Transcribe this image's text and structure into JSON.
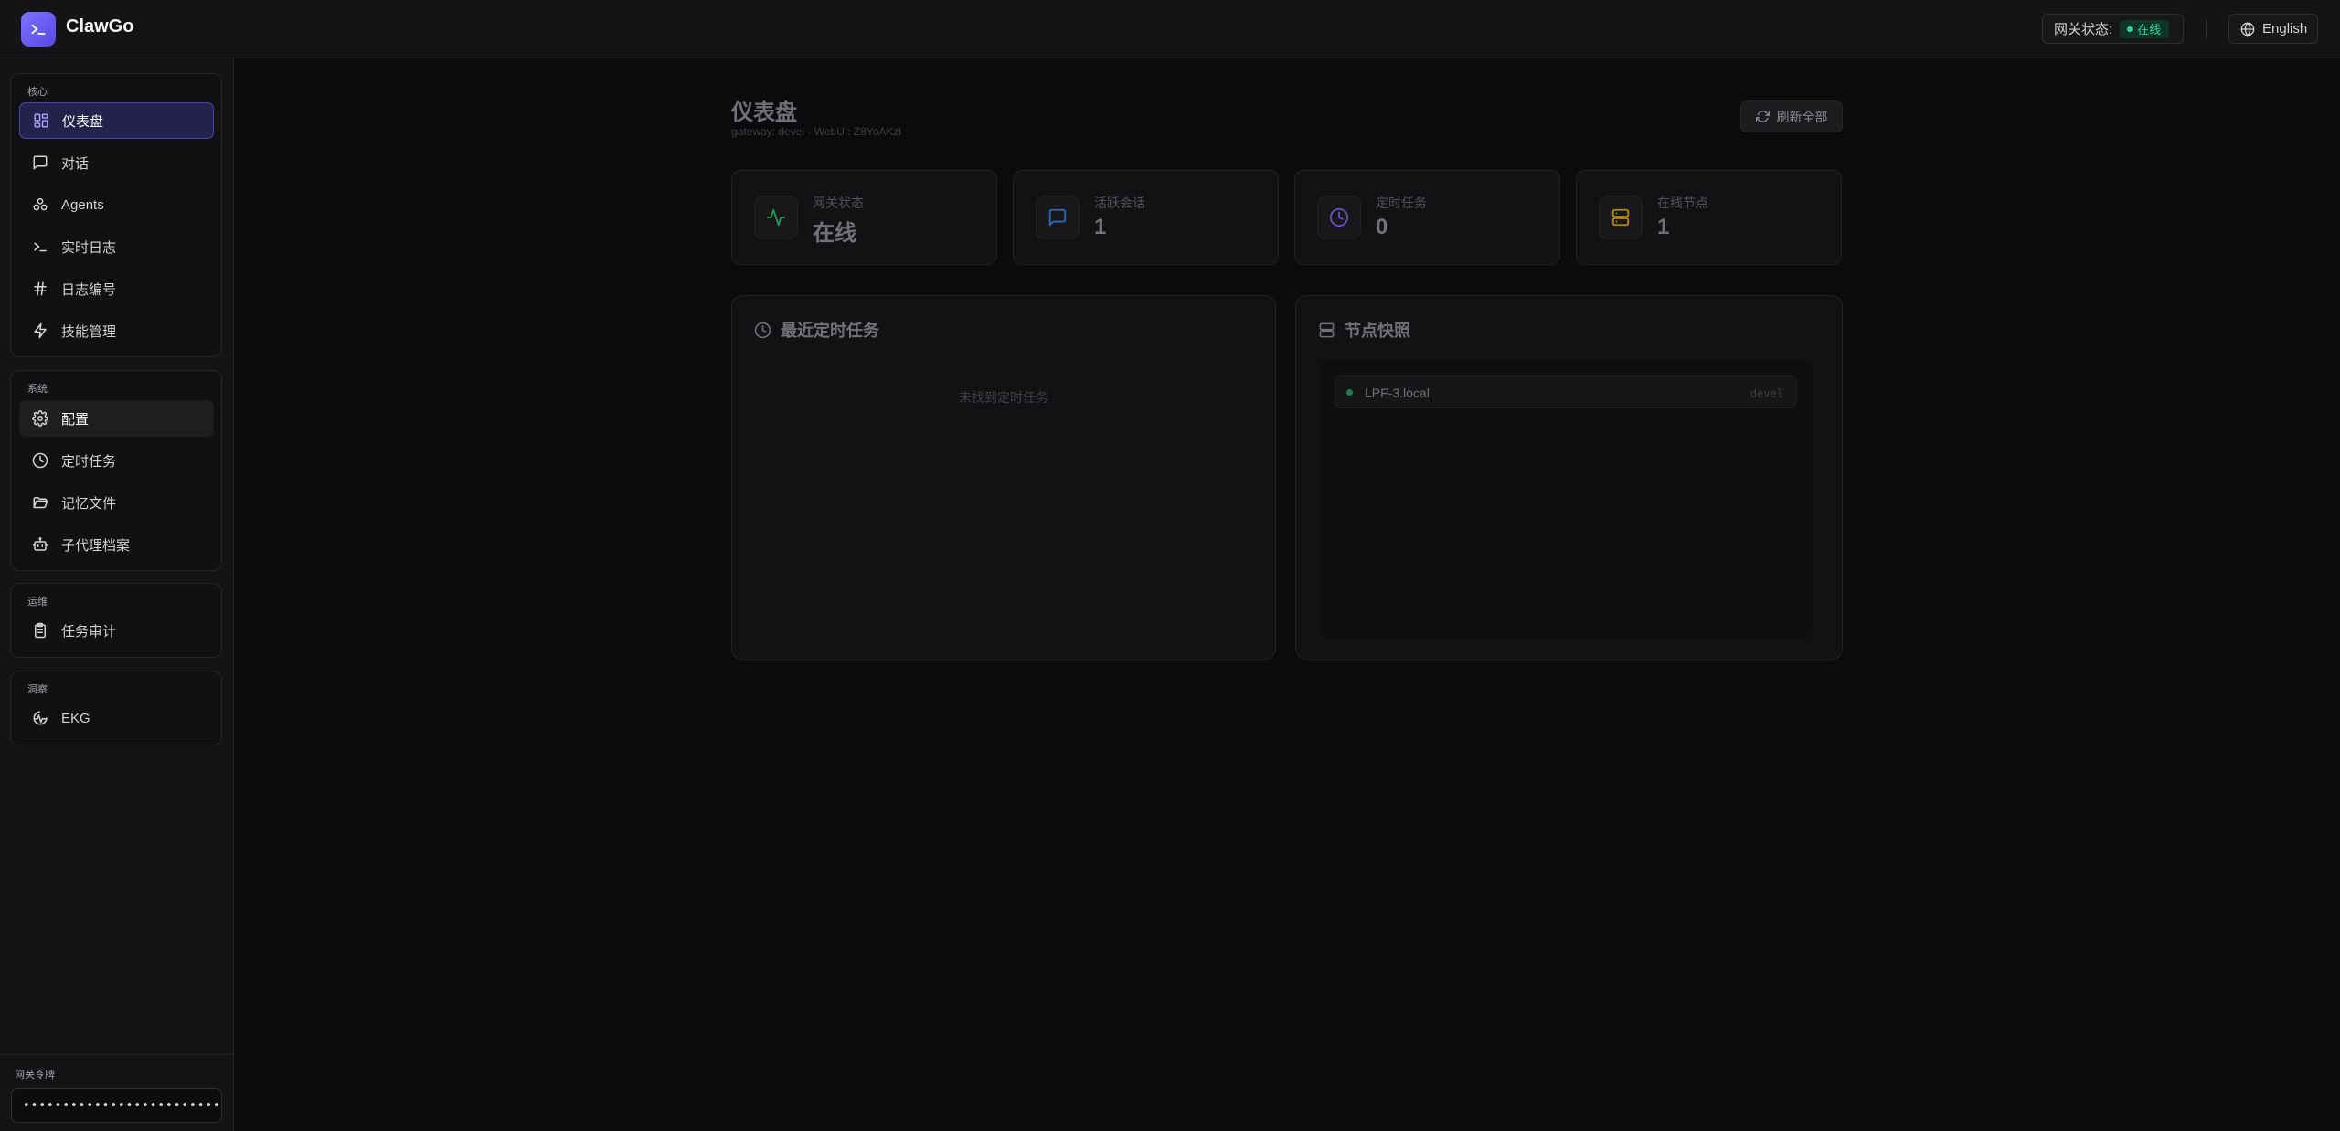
{
  "app": {
    "brand": "ClawGo",
    "gateway_status_label": "网关状态:",
    "gateway_status_value": "在线",
    "language": "English"
  },
  "sidebar": {
    "groups": [
      {
        "title": "核心",
        "items": [
          {
            "label": "仪表盘",
            "icon": "dashboard-icon",
            "active": true
          },
          {
            "label": "对话",
            "icon": "chat-icon"
          },
          {
            "label": "Agents",
            "icon": "agents-icon"
          },
          {
            "label": "实时日志",
            "icon": "terminal-icon"
          },
          {
            "label": "日志编号",
            "icon": "hash-icon"
          },
          {
            "label": "技能管理",
            "icon": "lightning-icon"
          }
        ]
      },
      {
        "title": "系统",
        "items": [
          {
            "label": "配置",
            "icon": "gear-icon",
            "hover": true
          },
          {
            "label": "定时任务",
            "icon": "clock-icon"
          },
          {
            "label": "记忆文件",
            "icon": "folder-icon"
          },
          {
            "label": "子代理档案",
            "icon": "robot-icon"
          }
        ]
      },
      {
        "title": "运维",
        "items": [
          {
            "label": "任务审计",
            "icon": "clipboard-icon"
          }
        ]
      },
      {
        "title": "洞察",
        "items": [
          {
            "label": "EKG",
            "icon": "ekg-icon"
          }
        ]
      }
    ],
    "token_label": "网关令牌",
    "token_value": "••••••••••••••••••••••••••••"
  },
  "main": {
    "title": "仪表盘",
    "subtitle": "gateway: devel · WebUI: Z8YoAKzl",
    "refresh_label": "刷新全部",
    "stats": [
      {
        "label": "网关状态",
        "value": "在线",
        "icon": "activity-icon",
        "color": "#22c55e"
      },
      {
        "label": "活跃会话",
        "value": "1",
        "icon": "chat-icon",
        "color": "#3b82f6"
      },
      {
        "label": "定时任务",
        "value": "0",
        "icon": "clock-icon",
        "color": "#8b5cf6"
      },
      {
        "label": "在线节点",
        "value": "1",
        "icon": "server-icon",
        "color": "#eab308"
      }
    ],
    "cron_panel": {
      "title": "最近定时任务",
      "empty": "未找到定时任务"
    },
    "nodes_panel": {
      "title": "节点快照",
      "nodes": [
        {
          "name": "LPF-3.local",
          "tag": "devel"
        }
      ]
    }
  }
}
